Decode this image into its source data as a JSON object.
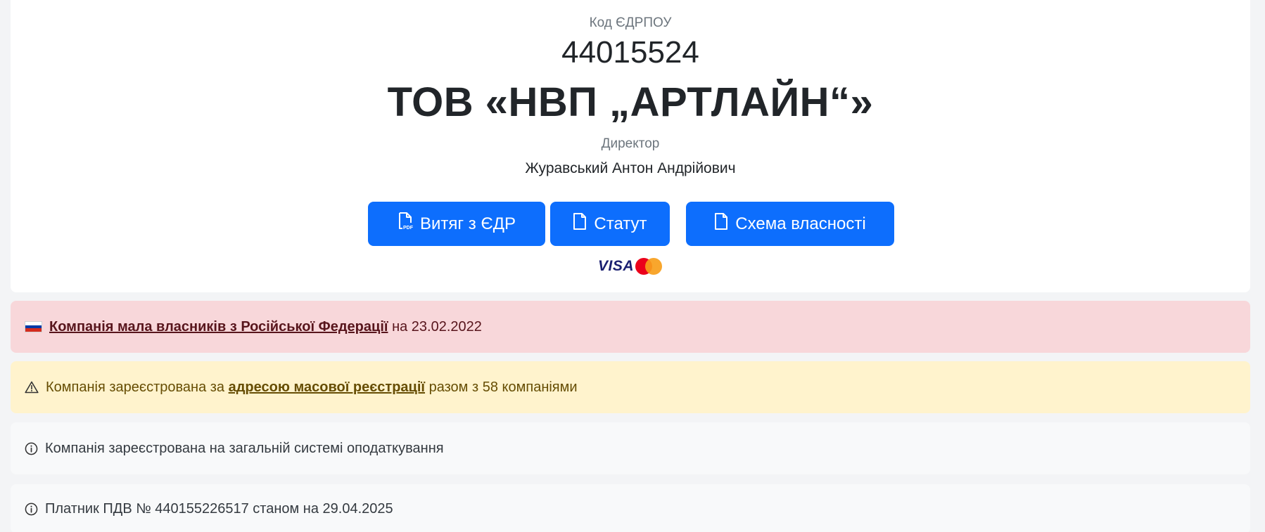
{
  "header": {
    "code_label": "Код ЄДРПОУ",
    "code_value": "44015524",
    "company_name": "ТОВ «НВП „АРТЛАЙН“»",
    "role_label": "Директор",
    "person_name": "Журавський Антон Андрійович"
  },
  "buttons": [
    {
      "label": "Витяг з ЄДР",
      "icon": "pdf-file-icon"
    },
    {
      "label": "Статут",
      "icon": "file-icon"
    },
    {
      "label": "Схема власності",
      "icon": "file-icon"
    }
  ],
  "payments": {
    "visa_text": "VISA",
    "icons": [
      "visa-logo",
      "mastercard-logo"
    ]
  },
  "alerts": [
    {
      "type": "danger",
      "icon": "russia-flag-icon",
      "link_text": "Компанія мала власників з Російської Федерації",
      "suffix": "на 23.02.2022",
      "color": "#f8d7da"
    },
    {
      "type": "warning",
      "icon": "warning-triangle-icon",
      "prefix": "Компанія зареєстрована за",
      "link_text": "адресою масової реєстрації",
      "suffix": "разом з 58 компаніями",
      "color": "#fff3cd"
    },
    {
      "type": "info",
      "icon": "info-circle-icon",
      "text": "Компанія зареєстрована на загальній системі оподаткування",
      "color": "#f8f9fa"
    },
    {
      "type": "info",
      "icon": "info-circle-icon",
      "text": "Платник ПДВ № 440155226517 станом на 29.04.2025",
      "color": "#f8f9fa"
    }
  ],
  "colors": {
    "primary": "#0d6efd",
    "danger_bg": "#f8d7da",
    "warning_bg": "#fff3cd",
    "info_bg": "#f8f9fa"
  }
}
